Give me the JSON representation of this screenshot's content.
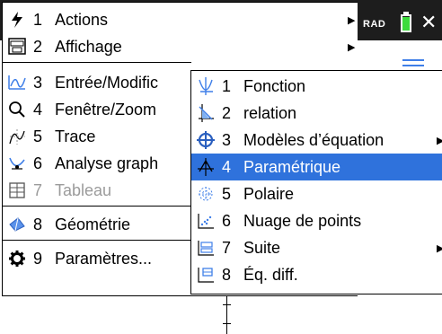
{
  "header": {
    "angle_mode": "RAD",
    "close_icon": "close-icon",
    "battery_icon": "battery-icon"
  },
  "main_menu": {
    "items": [
      {
        "number": "1",
        "label": "Actions",
        "icon": "lightning-icon",
        "has_submenu": true
      },
      {
        "number": "2",
        "label": "Affichage",
        "icon": "view-icon",
        "has_submenu": true
      },
      {
        "number": "3",
        "label": "Entrée/Modific",
        "icon": "graph-entry-icon",
        "has_submenu": true,
        "selected_parent": true
      },
      {
        "number": "4",
        "label": "Fenêtre/Zoom",
        "icon": "magnifier-icon",
        "has_submenu": true
      },
      {
        "number": "5",
        "label": "Trace",
        "icon": "trace-icon",
        "has_submenu": true
      },
      {
        "number": "6",
        "label": "Analyse graph",
        "icon": "analyze-icon",
        "has_submenu": true
      },
      {
        "number": "7",
        "label": "Tableau",
        "icon": "table-icon",
        "disabled": true
      },
      {
        "number": "8",
        "label": "Géométrie",
        "icon": "geometry-icon",
        "has_submenu": true
      },
      {
        "number": "9",
        "label": "Paramètres...",
        "icon": "gear-icon"
      }
    ]
  },
  "submenu": {
    "items": [
      {
        "number": "1",
        "label": "Fonction",
        "icon": "function-icon"
      },
      {
        "number": "2",
        "label": "relation",
        "icon": "relation-icon"
      },
      {
        "number": "3",
        "label": "Modèles d’équation",
        "icon": "equation-templates-icon",
        "has_submenu": true
      },
      {
        "number": "4",
        "label": "Paramétrique",
        "icon": "parametric-icon",
        "selected": true
      },
      {
        "number": "5",
        "label": "Polaire",
        "icon": "polar-icon"
      },
      {
        "number": "6",
        "label": "Nuage de points",
        "icon": "scatter-icon"
      },
      {
        "number": "7",
        "label": "Suite",
        "icon": "sequence-icon",
        "has_submenu": true
      },
      {
        "number": "8",
        "label": "Éq. diff.",
        "icon": "diff-eq-icon"
      }
    ]
  },
  "colors": {
    "selection": "#2f72dc",
    "disabled_text": "#9b9b9b",
    "header_bg": "#1d1d1d"
  }
}
